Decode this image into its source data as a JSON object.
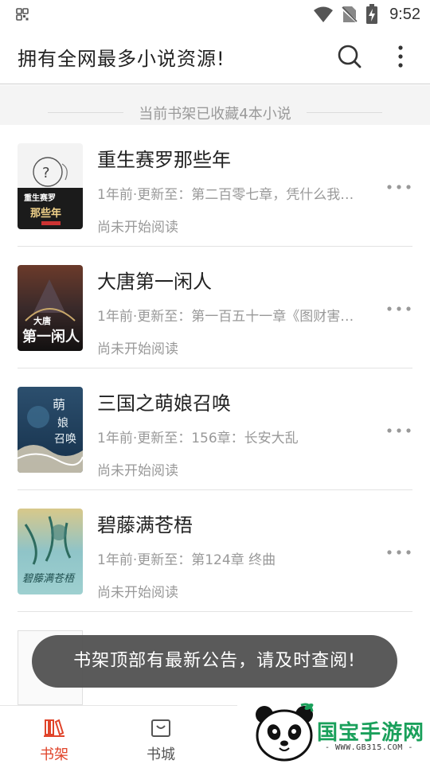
{
  "status_bar": {
    "time": "9:52"
  },
  "app_bar": {
    "title": "拥有全网最多小说资源!"
  },
  "shelf": {
    "count_text": "当前书架已收藏4本小说"
  },
  "books": [
    {
      "title": "重生赛罗那些年",
      "update": "1年前·更新至：第二百零七章，凭什么我…",
      "progress": "尚未开始阅读",
      "cover_text": "重生赛罗那些年"
    },
    {
      "title": "大唐第一闲人",
      "update": "1年前·更新至：第一百五十一章《图财害…",
      "progress": "尚未开始阅读",
      "cover_text": "大唐第一闲人"
    },
    {
      "title": "三国之萌娘召唤",
      "update": "1年前·更新至：156章：长安大乱",
      "progress": "尚未开始阅读",
      "cover_text": "萌娘召唤"
    },
    {
      "title": "碧藤满苍梧",
      "update": "1年前·更新至：第124章 终曲",
      "progress": "尚未开始阅读",
      "cover_text": "碧藤满苍梧"
    }
  ],
  "toast": {
    "text": "书架顶部有最新公告，请及时查阅!"
  },
  "bottom_nav": {
    "tabs": [
      {
        "label": "书架",
        "icon": "bookshelf-icon",
        "active": true
      },
      {
        "label": "书城",
        "icon": "shopping-bag-icon",
        "active": false
      }
    ]
  },
  "watermark": {
    "title": "国宝手游网",
    "url": "- WWW.GB315.COM -"
  },
  "colors": {
    "accent": "#e0442a",
    "toast_bg": "#555555",
    "watermark_green": "#1aa05b"
  }
}
